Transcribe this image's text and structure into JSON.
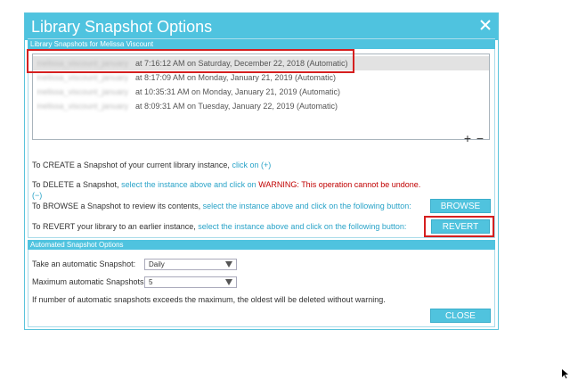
{
  "dialog": {
    "title": "Library Snapshot Options",
    "snapshots_header": "Library Snapshots for Melissa Viscount",
    "automated_header": "Automated Snapshot Options"
  },
  "snapshots": [
    {
      "name": "melissa_viscount_january",
      "time": "at 7:16:12 AM on Saturday, December 22, 2018 (Automatic)",
      "selected": true
    },
    {
      "name": "melissa_viscount_january",
      "time": "at 8:17:09 AM on Monday, January 21, 2019 (Automatic)"
    },
    {
      "name": "melissa_viscount_january",
      "time": "at 10:35:31 AM on Monday, January 21, 2019 (Automatic)"
    },
    {
      "name": "melissa_viscount_january",
      "time": "at 8:09:31 AM on Tuesday, January 22, 2019 (Automatic)"
    }
  ],
  "list_controls": {
    "add": "+",
    "remove": "−"
  },
  "create": {
    "text": "To CREATE a Snapshot of your current library instance,",
    "link": "click on (+)"
  },
  "delete": {
    "text": "To DELETE a Snapshot,",
    "link": "select the instance above and click on",
    "warning": "WARNING: This operation cannot be undone.",
    "link2": "(−)"
  },
  "browse": {
    "text": "To BROWSE a Snapshot to review its contents,",
    "link": "select the instance above and click on the following button:",
    "button": "BROWSE"
  },
  "revert": {
    "text": "To REVERT your library to an earlier instance,",
    "link": "select the instance above and click on the following button:",
    "button": "REVERT"
  },
  "automatic": {
    "take_label": "Take an automatic Snapshot:",
    "take_value": "Daily",
    "max_label": "Maximum automatic Snapshots",
    "max_value": "5",
    "note": "If number of automatic snapshots exceeds the maximum, the oldest will be deleted without warning.",
    "close_button": "CLOSE"
  },
  "colors": {
    "accent": "#4fc3df",
    "link": "#29a3c8",
    "warning": "#c00000",
    "highlight": "#d51f1f"
  }
}
